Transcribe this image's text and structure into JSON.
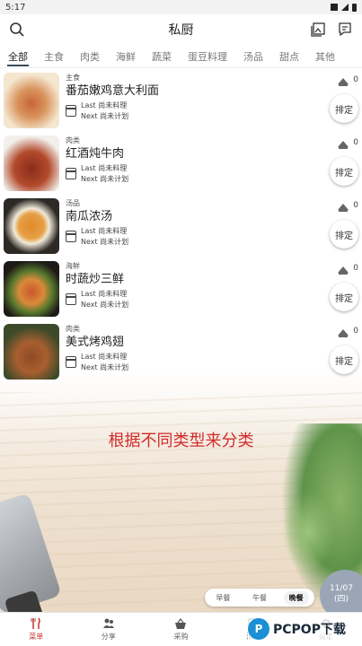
{
  "status": {
    "time": "5:17"
  },
  "header": {
    "title": "私厨"
  },
  "tabs": [
    "全部",
    "主食",
    "肉类",
    "海鲜",
    "蔬菜",
    "蛋豆料理",
    "汤品",
    "甜点",
    "其他"
  ],
  "recipes": [
    {
      "category": "主食",
      "name": "番茄嫩鸡意大利面",
      "last": "Last 尚未料理",
      "next": "Next 尚未计划",
      "count": "0",
      "plan_label": "排定",
      "thumb_colors": [
        "#f4e6cf",
        "#c8643a"
      ]
    },
    {
      "category": "肉类",
      "name": "红酒炖牛肉",
      "last": "Last 尚未料理",
      "next": "Next 尚未计划",
      "count": "0",
      "plan_label": "排定",
      "thumb_colors": [
        "#f2f0ec",
        "#8a2c1c"
      ]
    },
    {
      "category": "汤品",
      "name": "南瓜浓汤",
      "last": "Last 尚未料理",
      "next": "Next 尚未计划",
      "count": "0",
      "plan_label": "排定",
      "thumb_colors": [
        "#2d2a26",
        "#e08a2a"
      ]
    },
    {
      "category": "海鲜",
      "name": "时蔬炒三鲜",
      "last": "Last 尚未料理",
      "next": "Next 尚未计划",
      "count": "0",
      "plan_label": "排定",
      "thumb_colors": [
        "#1d1a17",
        "#c9572b"
      ]
    },
    {
      "category": "肉类",
      "name": "美式烤鸡翅",
      "last": "Last 尚未料理",
      "next": "Next 尚未计划",
      "count": "0",
      "plan_label": "排定",
      "thumb_colors": [
        "#3d4a2a",
        "#8e4a24"
      ]
    }
  ],
  "annotation": "根据不同类型来分类",
  "meal_selector": {
    "breakfast": "早餐",
    "lunch": "午餐",
    "dinner": "晚餐",
    "selected": "晚餐"
  },
  "date": {
    "day": "11/07",
    "weekday": "(四)"
  },
  "bottom_nav": [
    {
      "label": "菜单",
      "icon": "utensils-icon",
      "active": true
    },
    {
      "label": "分享",
      "icon": "people-icon",
      "active": false
    },
    {
      "label": "采购",
      "icon": "basket-icon",
      "active": false
    },
    {
      "label": "清单",
      "icon": "list-icon",
      "active": false
    },
    {
      "label": "设定",
      "icon": "settings-icon",
      "active": false
    }
  ],
  "watermark": {
    "letter": "P",
    "text": "PCPOP下载"
  },
  "colors": {
    "accent_red": "#c53030",
    "annotation_red": "#d22b2b",
    "date_circle": "#9aa6b6"
  }
}
